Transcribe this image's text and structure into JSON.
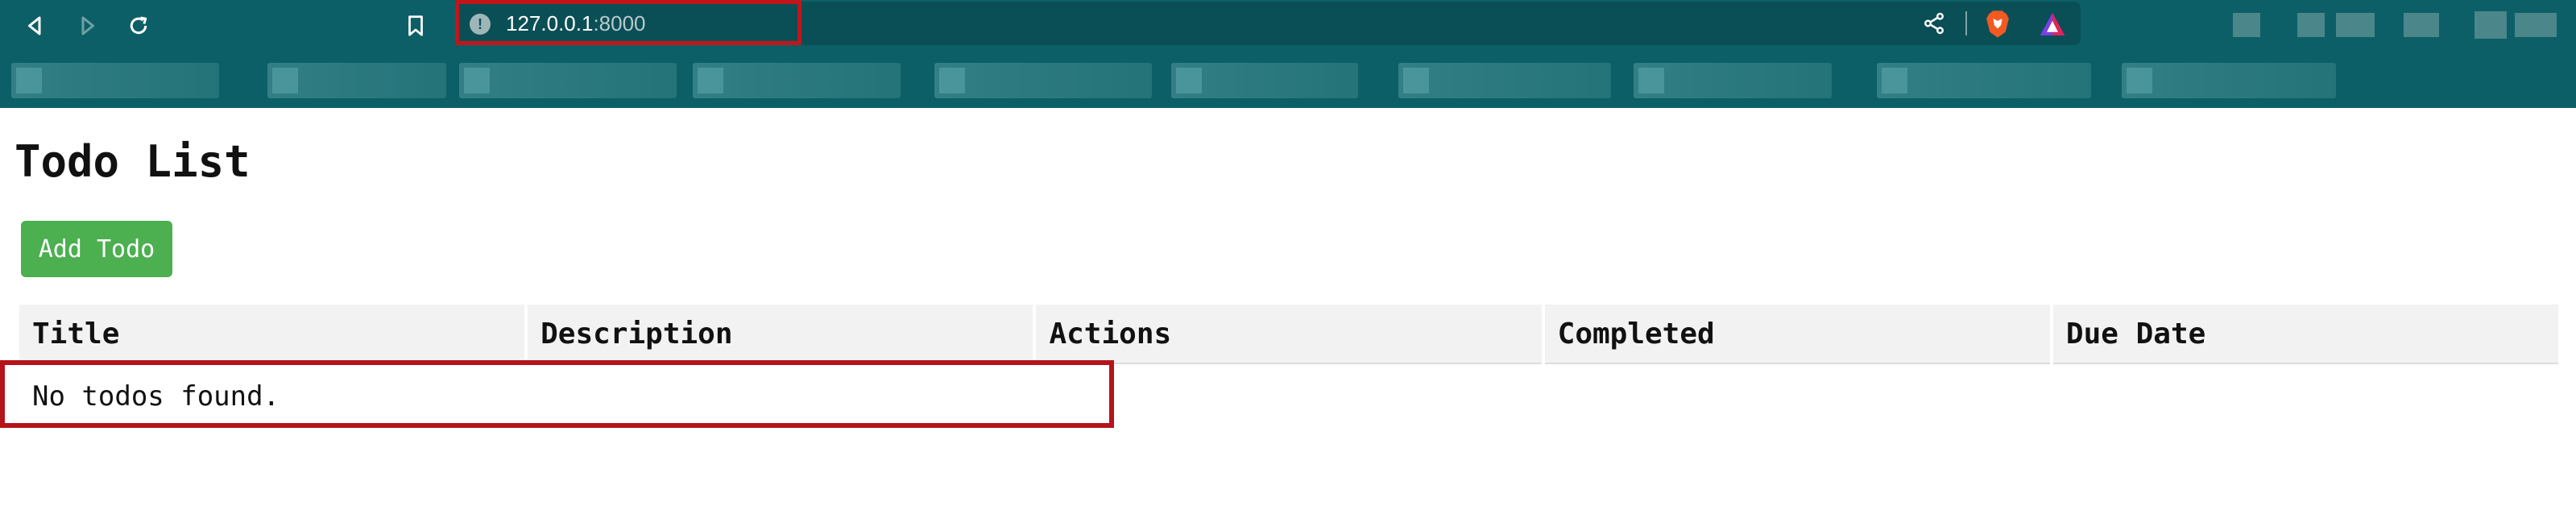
{
  "browser": {
    "url_host": "127.0.0.1",
    "url_port": ":8000",
    "icons": [
      "back-icon",
      "forward-icon",
      "reload-icon",
      "bookmark-icon",
      "site-info-icon",
      "share-icon",
      "brave-shields-icon",
      "brave-rewards-icon"
    ]
  },
  "page": {
    "title": "Todo List",
    "add_button_label": "Add Todo"
  },
  "table": {
    "columns": [
      "Title",
      "Description",
      "Actions",
      "Completed",
      "Due Date"
    ],
    "empty_message": "No todos found."
  },
  "colors": {
    "chrome": "#0c5f66",
    "primary_button": "#4caf50",
    "highlight": "#c0161b",
    "header_bg": "#f2f2f2"
  }
}
